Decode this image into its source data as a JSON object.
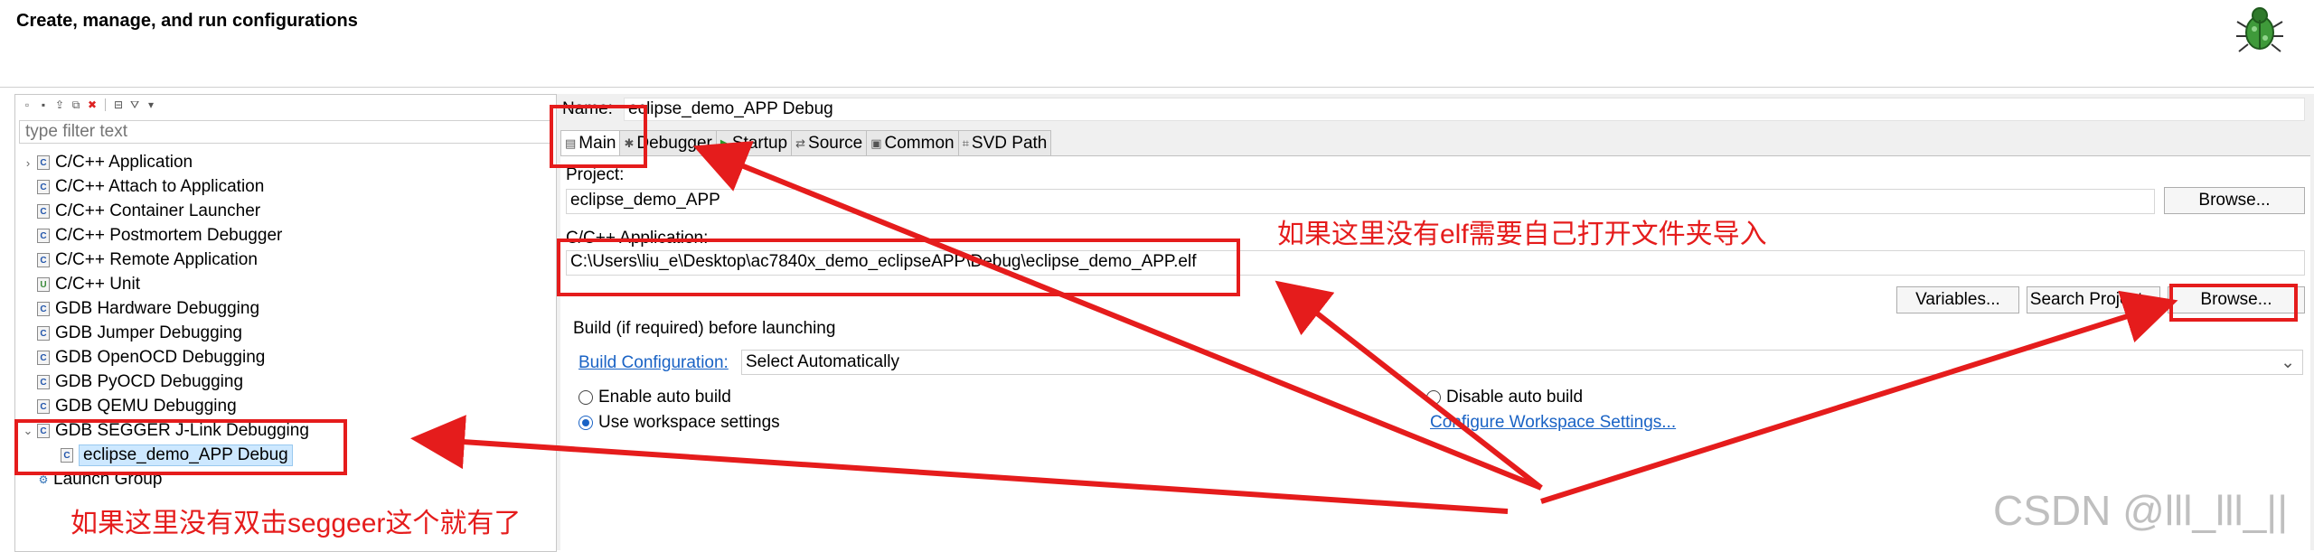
{
  "header": {
    "title": "Create, manage, and run configurations",
    "logo_icon": "bug-icon"
  },
  "filter": {
    "placeholder": "type filter text"
  },
  "tree": {
    "items": [
      "C/C++ Application",
      "C/C++ Attach to Application",
      "C/C++ Container Launcher",
      "C/C++ Postmortem Debugger",
      "C/C++ Remote Application",
      "C/C++ Unit",
      "GDB Hardware Debugging",
      "GDB Jumper Debugging",
      "GDB OpenOCD Debugging",
      "GDB PyOCD Debugging",
      "GDB QEMU Debugging",
      "GDB SEGGER J-Link Debugging",
      "eclipse_demo_APP Debug",
      "Launch Group"
    ]
  },
  "config": {
    "name_label": "Name:",
    "name_value": "eclipse_demo_APP Debug",
    "tabs": [
      "Main",
      "Debugger",
      "Startup",
      "Source",
      "Common",
      "SVD Path"
    ],
    "project_label": "Project:",
    "project_value": "eclipse_demo_APP",
    "browse_label": "Browse...",
    "app_label": "C/C++ Application:",
    "app_value": "C:\\Users\\liu_e\\Desktop\\ac7840x_demo_eclipseAPP\\Debug\\eclipse_demo_APP.elf",
    "variables_label": "Variables...",
    "search_project_label": "Search Project...",
    "build_group_label": "Build (if required) before launching",
    "build_config_link": "Build Configuration:",
    "build_config_value": "Select Automatically",
    "enable_auto_build": "Enable auto build",
    "disable_auto_build": "Disable auto build",
    "use_workspace_settings": "Use workspace settings",
    "configure_workspace_link": "Configure Workspace Settings..."
  },
  "annotations": {
    "note_elf": "如果这里没有elf需要自己打开文件夹导入",
    "note_segger": "如果这里没有双击seggeer这个就有了",
    "accent_color": "#e51c1c"
  },
  "watermark": "CSDN @lll_lll_||"
}
